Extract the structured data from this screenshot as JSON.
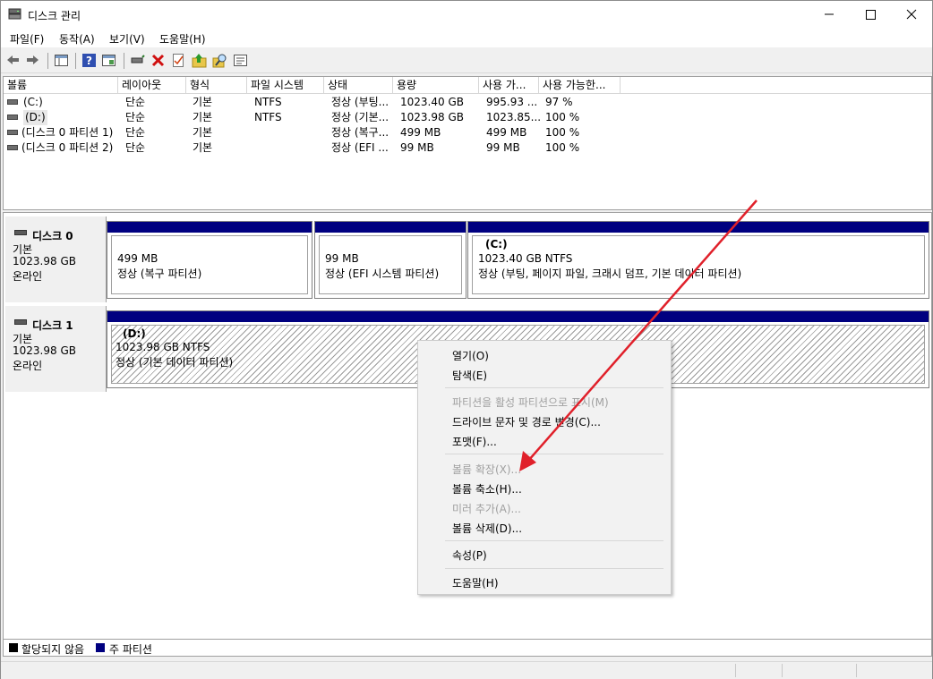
{
  "window": {
    "title": "디스크 관리"
  },
  "menu": [
    "파일(F)",
    "동작(A)",
    "보기(V)",
    "도움말(H)"
  ],
  "toolbar_icons": [
    "back-arrow-icon",
    "forward-arrow-icon",
    "console-tree-icon",
    "help-icon",
    "properties-icon",
    "connect-drive-icon",
    "delete-icon",
    "checklist-icon",
    "up-folder-icon",
    "search-icon",
    "settings-icon"
  ],
  "volumes": {
    "columns": [
      "볼륨",
      "레이아웃",
      "형식",
      "파일 시스템",
      "상태",
      "용량",
      "사용 가...",
      "사용 가능한..."
    ],
    "rows": [
      [
        "(C:)",
        "단순",
        "기본",
        "NTFS",
        "정상 (부팅...",
        "1023.40 GB",
        "995.93 ...",
        "97 %"
      ],
      [
        "(D:)",
        "단순",
        "기본",
        "NTFS",
        "정상 (기본...",
        "1023.98 GB",
        "1023.85...",
        "100 %"
      ],
      [
        "(디스크 0 파티션 1)",
        "단순",
        "기본",
        "",
        "정상 (복구...",
        "499 MB",
        "499 MB",
        "100 %"
      ],
      [
        "(디스크 0 파티션 2)",
        "단순",
        "기본",
        "",
        "정상 (EFI ...",
        "99 MB",
        "99 MB",
        "100 %"
      ]
    ]
  },
  "disks": [
    {
      "name": "디스크 0",
      "type": "기본",
      "size": "1023.98 GB",
      "status": "온라인",
      "partitions": [
        {
          "label": "",
          "size": "499 MB",
          "status": "정상 (복구 파티션)"
        },
        {
          "label": "",
          "size": "99 MB",
          "status": "정상 (EFI 시스템 파티션)"
        },
        {
          "label": "(C:)",
          "size": "1023.40 GB NTFS",
          "status": "정상 (부팅, 페이지 파일, 크래시 덤프, 기본 데이터 파티션)"
        }
      ]
    },
    {
      "name": "디스크 1",
      "type": "기본",
      "size": "1023.98 GB",
      "status": "온라인",
      "partitions": [
        {
          "label": "(D:)",
          "size": "1023.98 GB NTFS",
          "status": "정상 (기본 데이터 파티션)"
        }
      ]
    }
  ],
  "context_menu": {
    "open": "열기(O)",
    "explore": "탐색(E)",
    "mark_active": "파티션을 활성 파티션으로 표시(M)",
    "change_letter": "드라이브 문자 및 경로 변경(C)...",
    "format": "포맷(F)...",
    "extend": "볼륨 확장(X)...",
    "shrink": "볼륨 축소(H)...",
    "add_mirror": "미러 추가(A)...",
    "delete": "볼륨 삭제(D)...",
    "properties": "속성(P)",
    "help": "도움말(H)"
  },
  "legend": {
    "unallocated": "할당되지 않음",
    "primary": "주 파티션"
  },
  "colors": {
    "primary": "#000080",
    "unallocated": "#000000",
    "arrow": "#e0202a"
  }
}
